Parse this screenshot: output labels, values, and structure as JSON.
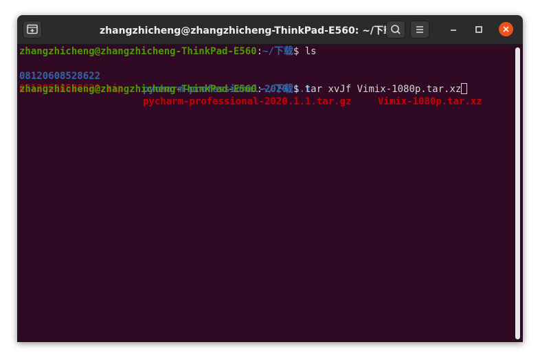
{
  "window": {
    "title": "zhangzhicheng@zhangzhicheng-ThinkPad-E560: ~/下载"
  },
  "colors": {
    "background": "#300a24",
    "prompt_user": "#4e9a06",
    "prompt_path": "#3465a4",
    "directory": "#3465a4",
    "archive": "#cc0000",
    "close_button": "#e95420"
  },
  "icons": {
    "new_tab": "new-tab-icon",
    "search": "search-icon",
    "menu": "hamburger-menu-icon",
    "minimize": "minimize-icon",
    "maximize": "maximize-icon",
    "close": "close-icon"
  },
  "terminal": {
    "lines": [
      {
        "user": "zhangzhicheng@zhangzhicheng-ThinkPad-E560",
        "sep": ":",
        "path": "~/下载",
        "symbol": "$ ",
        "command": "ls"
      }
    ],
    "ls_row1": {
      "col1": "08120608528622",
      "col2": "pycharm-professional-2020.1.1",
      "col3": "Vimix-1080p.tar.xz"
    },
    "ls_row2": {
      "col1": "08120608528622.zip",
      "col2": "pycharm-professional-2020.1.1.tar.gz"
    },
    "prompt2": {
      "user": "zhangzhicheng@zhangzhicheng-ThinkPad-E560",
      "sep": ":",
      "path": "~/下载",
      "symbol": "$ ",
      "command": "tar xvJf Vimix-1080p.tar.xz"
    }
  }
}
